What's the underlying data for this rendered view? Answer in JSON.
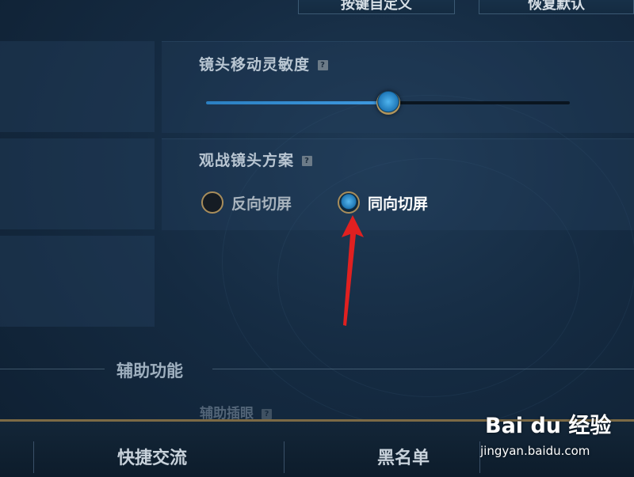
{
  "top_buttons": {
    "custom_label": "按键自定义",
    "reset_label": "恢复默认"
  },
  "camera_sensitivity": {
    "title": "镜头移动灵敏度",
    "help": "?",
    "value_percent": 50
  },
  "spectator_camera": {
    "title": "观战镜头方案",
    "help": "?",
    "options": [
      "反向切屏",
      "同向切屏"
    ],
    "selected": "同向切屏"
  },
  "section": {
    "title": "辅助功能",
    "next_item": "辅助插眼",
    "next_help": "?"
  },
  "bottom_tabs": [
    "快捷交流",
    "黑名单"
  ],
  "watermark": {
    "brand": "Bai du 经验",
    "url": "jingyan.baidu.com"
  },
  "colors": {
    "accent_blue": "#3f9ae0",
    "gold_border": "#a88d5b",
    "annotation_arrow": "#e02020"
  }
}
